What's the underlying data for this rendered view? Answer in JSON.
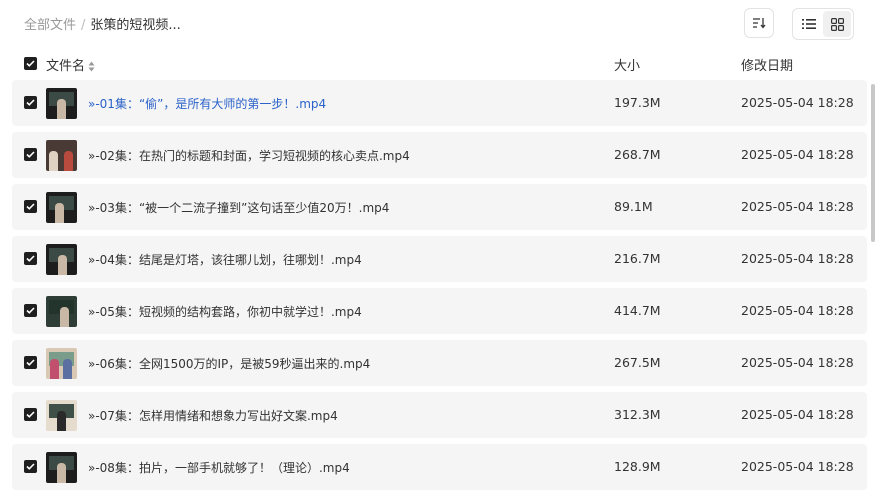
{
  "breadcrumb": {
    "root": "全部文件",
    "separator": "/",
    "current": "张策的短视频..."
  },
  "columns": {
    "name": "文件名",
    "size": "大小",
    "date": "修改日期"
  },
  "files": [
    {
      "name": "»-01集：“偷”，是所有大师的第一步！.mp4",
      "size": "197.3M",
      "date": "2025-05-04 18:28"
    },
    {
      "name": "»-02集：在热门的标题和封面，学习短视频的核心卖点.mp4",
      "size": "268.7M",
      "date": "2025-05-04 18:28"
    },
    {
      "name": "»-03集：“被一个二流子撞到”这句话至少值20万！.mp4",
      "size": "89.1M",
      "date": "2025-05-04 18:28"
    },
    {
      "name": "»-04集：结尾是灯塔，该往哪儿划，往哪划！.mp4",
      "size": "216.7M",
      "date": "2025-05-04 18:28"
    },
    {
      "name": "»-05集：短视频的结构套路，你初中就学过！.mp4",
      "size": "414.7M",
      "date": "2025-05-04 18:28"
    },
    {
      "name": "»-06集：全网1500万的IP，是被59秒逼出来的.mp4",
      "size": "267.5M",
      "date": "2025-05-04 18:28"
    },
    {
      "name": "»-07集：怎样用情绪和想象力写出好文案.mp4",
      "size": "312.3M",
      "date": "2025-05-04 18:28"
    },
    {
      "name": "»-08集：拍片，一部手机就够了！（理论）.mp4",
      "size": "128.9M",
      "date": "2025-05-04 18:28"
    }
  ],
  "colors": {
    "link": "#2a62c9",
    "row_bg": "#f5f5f5",
    "checkbox": "#1f1f1f"
  }
}
